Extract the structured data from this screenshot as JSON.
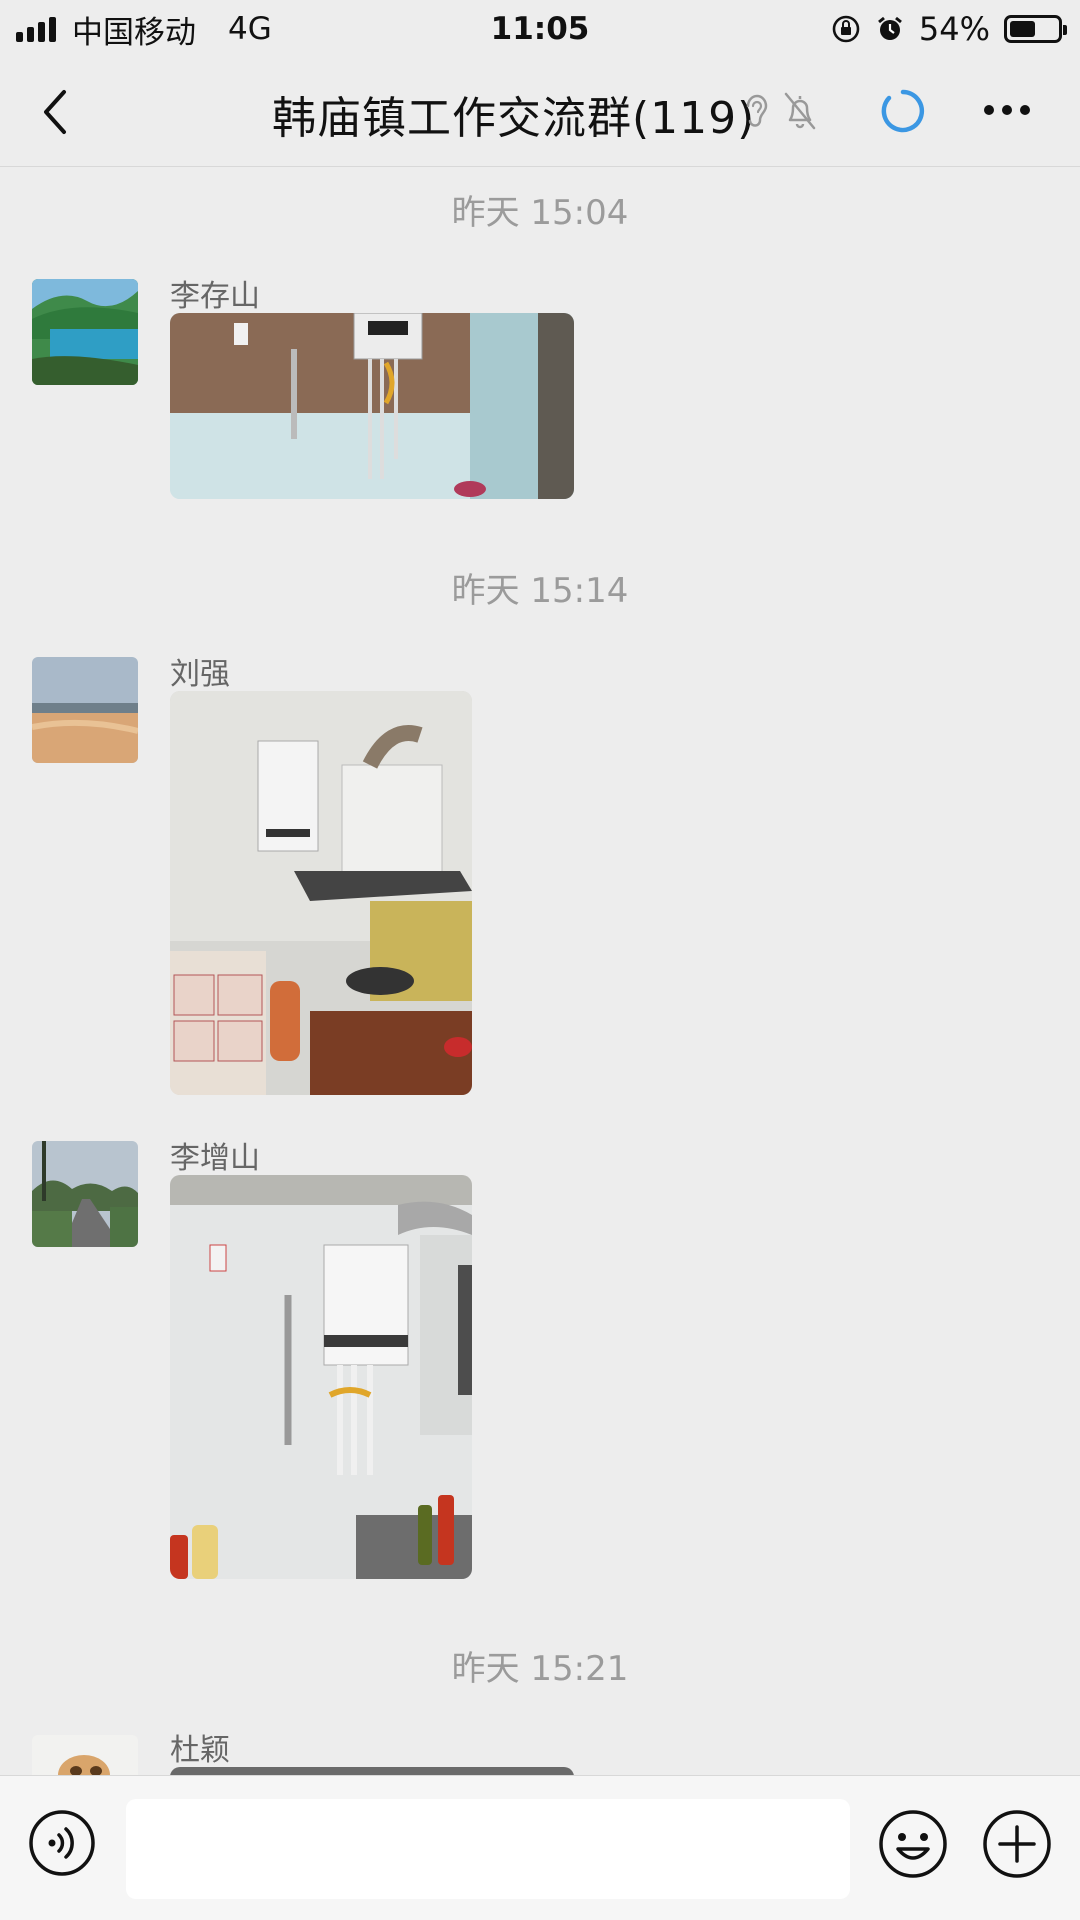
{
  "status_bar": {
    "carrier": "中国移动",
    "network": "4G",
    "time": "11:05",
    "battery_percent": "54%",
    "battery_level": 0.54,
    "icons": [
      "signal-icon",
      "orientation-lock-icon",
      "alarm-icon",
      "battery-icon"
    ]
  },
  "nav": {
    "title": "韩庙镇工作交流群(119)",
    "icons": [
      "back-chevron-icon",
      "ear-icon",
      "mute-bell-icon",
      "loading-spinner-icon",
      "more-icon"
    ]
  },
  "messages": [
    {
      "timestamp": "昨天 15:04",
      "sender": "李存山",
      "image": "photo-wall-boiler-pipes"
    },
    {
      "timestamp": "昨天 15:14",
      "sender": "刘强",
      "image": "photo-kitchen-boiler-stove"
    },
    {
      "timestamp": "",
      "sender": "李增山",
      "image": "photo-wall-boiler-white"
    },
    {
      "timestamp": "昨天 15:21",
      "sender": "杜颖",
      "image": "photo-partial"
    }
  ],
  "input_bar": {
    "placeholder": "",
    "icons": [
      "voice-icon",
      "emoji-icon",
      "plus-icon"
    ]
  },
  "colors": {
    "background": "#ededed",
    "timestamp": "#9b9b9b",
    "sender": "#666666",
    "spinner": "#3b97e3"
  }
}
